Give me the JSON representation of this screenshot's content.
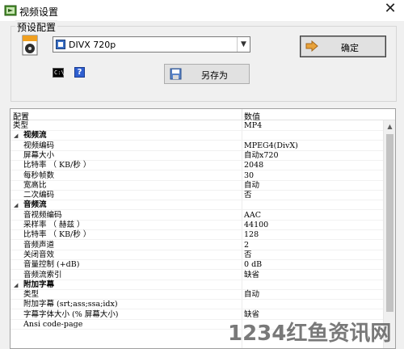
{
  "window": {
    "title": "视频设置",
    "close_glyph": "✕"
  },
  "preset": {
    "group_label": "预设配置",
    "selected": "DIVX 720p",
    "ok_label": "确定",
    "save_as_label": "另存为",
    "help_glyph": "?",
    "cmd_glyph": "C:\\"
  },
  "grid": {
    "header": {
      "name": "配置",
      "value": "数值"
    },
    "rows": [
      {
        "kind": "item",
        "indent": 0,
        "name": "类型",
        "value": "MP4"
      },
      {
        "kind": "category",
        "name": "视频流",
        "value": ""
      },
      {
        "kind": "item",
        "indent": 1,
        "name": "视频编码",
        "value": "MPEG4(DivX)"
      },
      {
        "kind": "item",
        "indent": 1,
        "name": "屏幕大小",
        "value": "自动x720"
      },
      {
        "kind": "item",
        "indent": 1,
        "name": "比特率 （ KB/秒 ）",
        "value": "2048"
      },
      {
        "kind": "item",
        "indent": 1,
        "name": "每秒帧数",
        "value": "30"
      },
      {
        "kind": "item",
        "indent": 1,
        "name": "宽高比",
        "value": "自动"
      },
      {
        "kind": "item",
        "indent": 1,
        "name": "二次编码",
        "value": "否"
      },
      {
        "kind": "category",
        "name": "音频流",
        "value": ""
      },
      {
        "kind": "item",
        "indent": 1,
        "name": "音视频编码",
        "value": "AAC"
      },
      {
        "kind": "item",
        "indent": 1,
        "name": "采样率 （ 赫兹 ）",
        "value": "44100"
      },
      {
        "kind": "item",
        "indent": 1,
        "name": "比特率 （ KB/秒 ）",
        "value": "128"
      },
      {
        "kind": "item",
        "indent": 1,
        "name": "音频声道",
        "value": "2"
      },
      {
        "kind": "item",
        "indent": 1,
        "name": "关闭音效",
        "value": "否"
      },
      {
        "kind": "item",
        "indent": 1,
        "name": "音量控制 (+dB)",
        "value": "0 dB"
      },
      {
        "kind": "item",
        "indent": 1,
        "name": "音频流索引",
        "value": "缺省"
      },
      {
        "kind": "category",
        "name": "附加字幕",
        "value": ""
      },
      {
        "kind": "item",
        "indent": 1,
        "name": "类型",
        "value": "自动"
      },
      {
        "kind": "item",
        "indent": 1,
        "name": "附加字幕 (srt;ass;ssa;idx)",
        "value": ""
      },
      {
        "kind": "item",
        "indent": 1,
        "name": "字幕字体大小 (% 屏幕大小)",
        "value": "缺省"
      },
      {
        "kind": "item",
        "indent": 1,
        "name": "Ansi code-page",
        "value": ""
      }
    ]
  },
  "watermark": "1234红鱼资讯网",
  "colors": {
    "button_border": "#3c3c3c",
    "combo_icon": "#3a6fc4",
    "grid_bg": "#ffffff"
  }
}
